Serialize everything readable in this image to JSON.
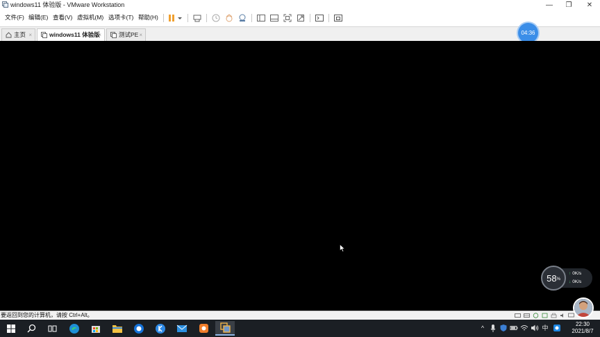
{
  "window": {
    "title": "windows11 体验版 - VMware Workstation",
    "controls": {
      "minimize": "—",
      "restore": "❐",
      "close": "✕"
    }
  },
  "menu": [
    "文件(F)",
    "编辑(E)",
    "查看(V)",
    "虚拟机(M)",
    "选项卡(T)",
    "帮助(H)"
  ],
  "toolbar": {
    "icons": [
      "pause-icon",
      "dropdown-arrow-icon",
      "send-ctrl-alt-del-icon",
      "snapshot-icon",
      "revert-snapshot-icon",
      "snapshot-manager-icon",
      "show-library-icon",
      "thumbnail-bar-icon",
      "fullscreen-icon",
      "unity-icon",
      "console-icon",
      "stretch-view-icon"
    ],
    "accent": "#f0a030"
  },
  "tabs": [
    {
      "label": "主页",
      "icon": "home-icon",
      "active": false
    },
    {
      "label": "windows11 体验版",
      "icon": "vm-icon",
      "active": true
    },
    {
      "label": "测试PE",
      "icon": "vm-icon",
      "active": false
    }
  ],
  "tab_close": "×",
  "timer": "04:36",
  "net_widget": {
    "usage_value": "58",
    "usage_unit": "%",
    "upload": "0",
    "download": "0",
    "unit": "K/s",
    "upload_arrow": "↑",
    "download_arrow": "↓"
  },
  "status": {
    "text": "要返回到您的计算机，请按 Ctrl+Alt。"
  },
  "taskbar": {
    "apps": [
      "start-icon",
      "search-icon",
      "task-view-icon",
      "edge-icon",
      "store-icon",
      "file-explorer-icon",
      "browser-icon",
      "kugou-icon",
      "mail-icon",
      "app-icon",
      "vmware-icon"
    ],
    "tray": {
      "chevron": "^",
      "ime": "中",
      "time": "22:30",
      "date": "2021/8/7"
    }
  },
  "colors": {
    "vm_screen": "#000000",
    "taskbar": "#1b1f24",
    "timer": "#3b8ee8"
  }
}
